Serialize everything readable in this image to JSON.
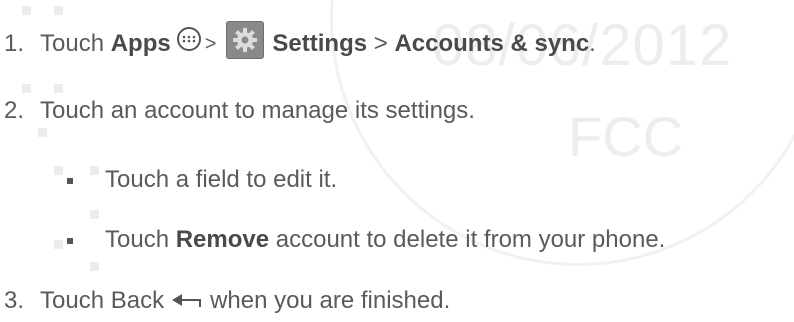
{
  "watermark": {
    "date": "08/06/2012",
    "agency": "FCC"
  },
  "steps": {
    "step1": {
      "number": "1.",
      "touch": "Touch",
      "apps": "Apps",
      "sep1": ">",
      "settings": "Settings",
      "sep2": ">",
      "accounts": "Accounts & sync",
      "period": "."
    },
    "step2": {
      "number": "2.",
      "text": "Touch an account to manage its settings."
    },
    "sub1": {
      "text": "Touch a field to edit it."
    },
    "sub2": {
      "pre": "Touch",
      "bold": "Remove",
      "post": "account to delete it from your phone."
    },
    "step3": {
      "number": "3.",
      "pre": "Touch Back",
      "post": "when you are finished."
    }
  },
  "icons": {
    "apps": "apps-grid-icon",
    "settings": "gear-icon",
    "back": "back-arrow-icon"
  }
}
